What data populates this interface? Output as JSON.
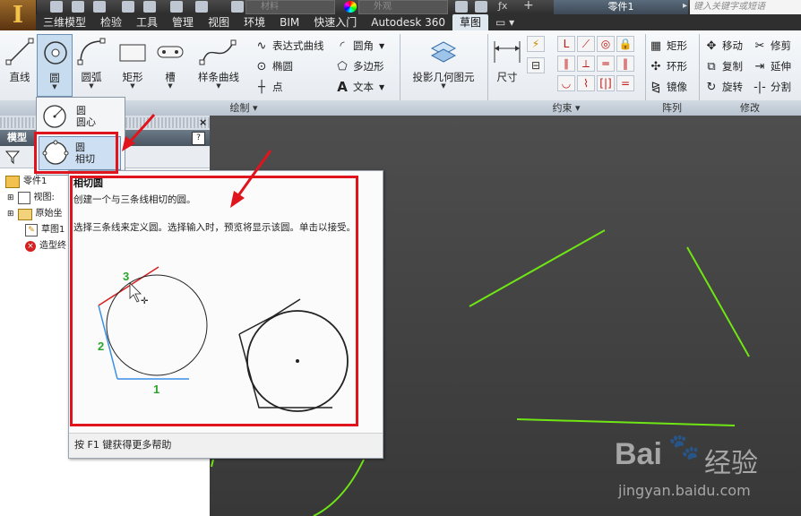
{
  "titlebar": {
    "material_placeholder": "材料",
    "appearance_placeholder": "外观",
    "document_title": "零件1",
    "search_placeholder": "键入关键字或短语"
  },
  "tabs": [
    "三维模型",
    "检验",
    "工具",
    "管理",
    "视图",
    "环境",
    "BIM",
    "快速入门",
    "Autodesk 360",
    "草图"
  ],
  "active_tab_index": 9,
  "ribbon": {
    "draw": {
      "line": "直线",
      "circle": "圆",
      "arc": "圆弧",
      "rectangle": "矩形",
      "slot": "槽",
      "spline": "样条曲线",
      "equation_curve": "表达式曲线",
      "ellipse": "椭圆",
      "point": "点",
      "fillet": "圆角",
      "polygon": "多边形",
      "text": "文本",
      "project_geometry": "投影几何图元",
      "panel_label": "绘制"
    },
    "constrain": {
      "dimension": "尺寸",
      "panel_label": "约束"
    },
    "pattern": {
      "rectangular": "矩形",
      "circular": "环形",
      "mirror": "镜像",
      "panel_label": "阵列"
    },
    "modify": {
      "move": "移动",
      "trim": "修剪",
      "copy": "复制",
      "extend": "延伸",
      "rotate": "旋转",
      "split": "分割",
      "panel_label": "修改"
    }
  },
  "flyout": {
    "center_circle_line1": "圆",
    "center_circle_line2": "圆心",
    "tangent_circle_line1": "圆",
    "tangent_circle_line2": "相切"
  },
  "browser": {
    "header": "模型",
    "items": [
      "零件1",
      "视图:",
      "原始坐",
      "草图1",
      "造型终"
    ]
  },
  "tooltip": {
    "title": "相切圆",
    "description": "创建一个与三条线相切的圆。",
    "long_description": "选择三条线来定义圆。选择输入时，预览将显示该圆。单击以接受。",
    "footer": "按 F1 键获得更多帮助",
    "diagram_labels": [
      "3",
      "2",
      "1"
    ]
  },
  "watermark": {
    "brand": "Bai",
    "brand_tail": "经验",
    "url": "jingyan.baidu.com"
  },
  "colors": {
    "accent_red": "#e0141c",
    "sketch_green": "#6fe614",
    "label_green": "#2aa52a",
    "line_blue": "#3a8ee6",
    "line_red": "#d62020"
  }
}
